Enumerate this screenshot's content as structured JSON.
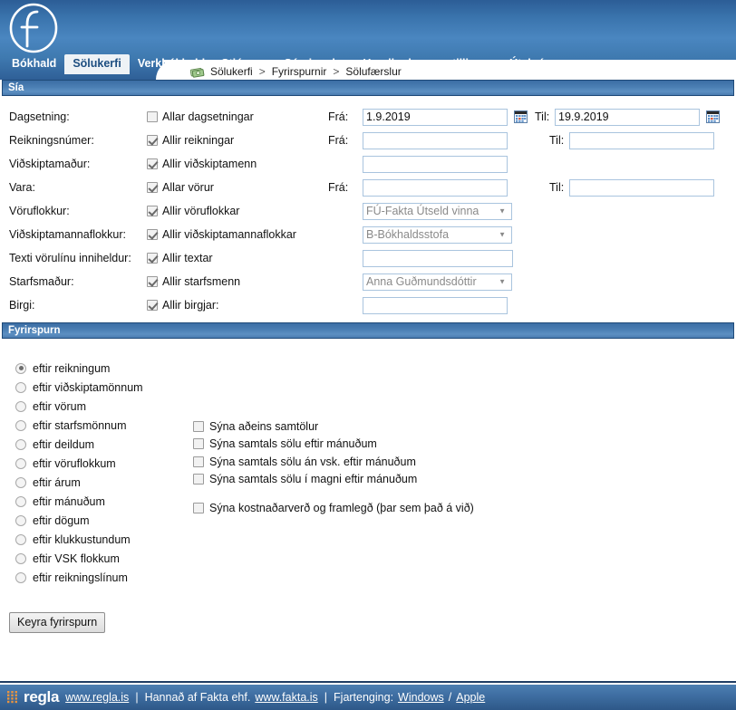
{
  "app": {
    "logo_letter": "f",
    "brand": "regla"
  },
  "nav": {
    "items": [
      {
        "label": "Bókhald",
        "active": false
      },
      {
        "label": "Sölukerfi",
        "active": true
      },
      {
        "label": "Verkbókhald",
        "active": false
      },
      {
        "label": "Stjórnun",
        "active": false
      },
      {
        "label": "Sérvinnslur",
        "active": false
      },
      {
        "label": "Handbækur og stillingar",
        "active": false
      },
      {
        "label": "Útskrá",
        "active": false
      }
    ]
  },
  "breadcrumb": {
    "icon": "money-icon",
    "items": [
      "Sölukerfi",
      "Fyrirspurnir",
      "Sölufærslur"
    ],
    "separator": ">"
  },
  "filter": {
    "title": "Sía",
    "from_label": "Frá:",
    "to_label": "Til:",
    "rows": [
      {
        "label": "Dagsetning:",
        "check_label": "Allar dagsetningar",
        "checked": false,
        "has_from": true,
        "from_value": "1.9.2019",
        "has_to": true,
        "to_value": "19.9.2019",
        "has_calendar": true,
        "control": "text"
      },
      {
        "label": "Reikningsnúmer:",
        "check_label": "Allir reikningar",
        "checked": true,
        "has_from": true,
        "from_value": "",
        "has_to": true,
        "to_value": "",
        "has_calendar": false,
        "control": "text"
      },
      {
        "label": "Viðskiptamaður:",
        "check_label": "Allir viðskiptamenn",
        "checked": true,
        "has_from": false,
        "from_value": "",
        "has_to": false,
        "to_value": "",
        "has_calendar": false,
        "control": "text"
      },
      {
        "label": "Vara:",
        "check_label": "Allar vörur",
        "checked": true,
        "has_from": true,
        "from_value": "",
        "has_to": true,
        "to_value": "",
        "has_calendar": false,
        "control": "text"
      },
      {
        "label": "Vöruflokkur:",
        "check_label": "Allir vöruflokkar",
        "checked": true,
        "has_from": false,
        "from_value": "",
        "has_to": false,
        "to_value": "",
        "has_calendar": false,
        "control": "select",
        "select_value": "FÚ-Fakta Útseld vinna"
      },
      {
        "label": "Viðskiptamannaflokkur:",
        "check_label": "Allir viðskiptamannaflokkar",
        "checked": true,
        "has_from": false,
        "from_value": "",
        "has_to": false,
        "to_value": "",
        "has_calendar": false,
        "control": "select",
        "select_value": "B-Bókhaldsstofa"
      },
      {
        "label": "Texti vörulínu inniheldur:",
        "check_label": "Allir textar",
        "checked": true,
        "has_from": false,
        "from_value": "",
        "has_to": false,
        "to_value": "",
        "has_calendar": false,
        "control": "text"
      },
      {
        "label": "Starfsmaður:",
        "check_label": "Allir starfsmenn",
        "checked": true,
        "has_from": false,
        "from_value": "",
        "has_to": false,
        "to_value": "",
        "has_calendar": false,
        "control": "select",
        "select_value": "Anna Guðmundsdóttir"
      },
      {
        "label": "Birgi:",
        "check_label": "Allir birgjar:",
        "checked": true,
        "has_from": false,
        "from_value": "",
        "has_to": false,
        "to_value": "",
        "has_calendar": false,
        "control": "text"
      }
    ]
  },
  "query": {
    "title": "Fyrirspurn",
    "radios": [
      {
        "label": "eftir reikningum",
        "selected": true
      },
      {
        "label": "eftir viðskiptamönnum",
        "selected": false
      },
      {
        "label": "eftir vörum",
        "selected": false
      },
      {
        "label": "eftir starfsmönnum",
        "selected": false
      },
      {
        "label": "eftir deildum",
        "selected": false
      },
      {
        "label": "eftir vöruflokkum",
        "selected": false
      },
      {
        "label": "eftir árum",
        "selected": false
      },
      {
        "label": "eftir mánuðum",
        "selected": false
      },
      {
        "label": "eftir dögum",
        "selected": false
      },
      {
        "label": "eftir klukkustundum",
        "selected": false
      },
      {
        "label": "eftir VSK flokkum",
        "selected": false
      },
      {
        "label": "eftir reikningslínum",
        "selected": false
      }
    ],
    "checkboxes": [
      {
        "label": "Sýna aðeins samtölur",
        "checked": false,
        "spaced": false
      },
      {
        "label": "Sýna samtals sölu eftir mánuðum",
        "checked": false,
        "spaced": false
      },
      {
        "label": "Sýna samtals sölu án vsk. eftir mánuðum",
        "checked": false,
        "spaced": false
      },
      {
        "label": "Sýna samtals sölu í magni eftir mánuðum",
        "checked": false,
        "spaced": false
      },
      {
        "label": "Sýna kostnaðarverð og framlegð (þar sem það á við)",
        "checked": false,
        "spaced": true
      }
    ],
    "run_button": "Keyra fyrirspurn"
  },
  "footer": {
    "brand": "regla",
    "site_link": "www.regla.is",
    "sep1": "|",
    "designed_by": "Hannað af Fakta ehf.",
    "fakta_link": "www.fakta.is",
    "sep2": "|",
    "remote_label": "Fjartenging:",
    "windows_link": "Windows",
    "slash": "/",
    "apple_link": "Apple"
  },
  "colors": {
    "header_blue": "#3a74ad",
    "section_blue": "#4b7fb4",
    "accent_orange": "#e08a2e",
    "input_border": "#a9c4de"
  }
}
